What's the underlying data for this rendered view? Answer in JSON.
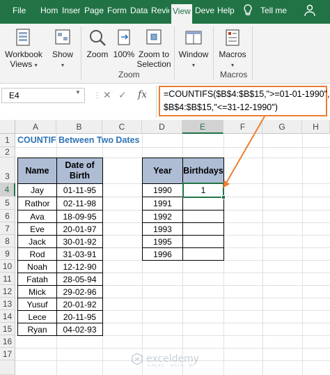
{
  "ribbon": {
    "tabs": [
      "File",
      "Hom",
      "Inser",
      "Page",
      "Form",
      "Data",
      "Revie",
      "View",
      "Deve",
      "Help"
    ],
    "active_tab": "View",
    "tell_me": "Tell me",
    "buttons": {
      "workbook_views": "Workbook Views",
      "show": "Show",
      "zoom": "Zoom",
      "zoom100": "100%",
      "zoom_to_selection": "Zoom to Selection",
      "window": "Window",
      "macros": "Macros"
    },
    "groups": {
      "zoom": "Zoom",
      "macros": "Macros"
    }
  },
  "formula_bar": {
    "name_box": "E4",
    "cancel_glyph": "✕",
    "enter_glyph": "✓",
    "fx": "fx",
    "formula_line1": "=COUNTIFS($B$4:$B$15,\">=01-01-1990\",",
    "formula_line2": "$B$4:$B$15,\"<=31-12-1990\")"
  },
  "columns": [
    "A",
    "B",
    "C",
    "D",
    "E",
    "F",
    "G",
    "H"
  ],
  "selected_column": "E",
  "rows": [
    "1",
    "2",
    "3",
    "4",
    "5",
    "6",
    "7",
    "8",
    "9",
    "10",
    "11",
    "12",
    "13",
    "14",
    "15",
    "16",
    "17"
  ],
  "selected_row": "4",
  "sheet": {
    "title": "COUNTIF Between Two Dates",
    "table1": {
      "headers": [
        "Name",
        "Date of Birth"
      ],
      "rows": [
        [
          "Jay",
          "01-11-95"
        ],
        [
          "Rathor",
          "02-11-98"
        ],
        [
          "Ava",
          "18-09-95"
        ],
        [
          "Eve",
          "20-01-97"
        ],
        [
          "Jack",
          "30-01-92"
        ],
        [
          "Rod",
          "31-03-91"
        ],
        [
          "Noah",
          "12-12-90"
        ],
        [
          "Fatah",
          "28-05-94"
        ],
        [
          "Mick",
          "29-02-96"
        ],
        [
          "Yusuf",
          "20-01-92"
        ],
        [
          "Lece",
          "20-11-95"
        ],
        [
          "Ryan",
          "04-02-93"
        ]
      ]
    },
    "table2": {
      "headers": [
        "Year",
        "Birthdays"
      ],
      "rows": [
        [
          "1990",
          "1"
        ],
        [
          "1991",
          ""
        ],
        [
          "1992",
          ""
        ],
        [
          "1993",
          ""
        ],
        [
          "1995",
          ""
        ],
        [
          "1996",
          ""
        ]
      ]
    }
  },
  "watermark": {
    "name": "exceldemy",
    "tagline": "EXCEL · DATA · BI"
  },
  "colors": {
    "excel_green": "#217346",
    "header_fill": "#aebcd4",
    "title_blue": "#2e74b5",
    "annotation_orange": "#ed7d31"
  },
  "icons": {
    "search": "magnifier",
    "share": "person-icon"
  }
}
